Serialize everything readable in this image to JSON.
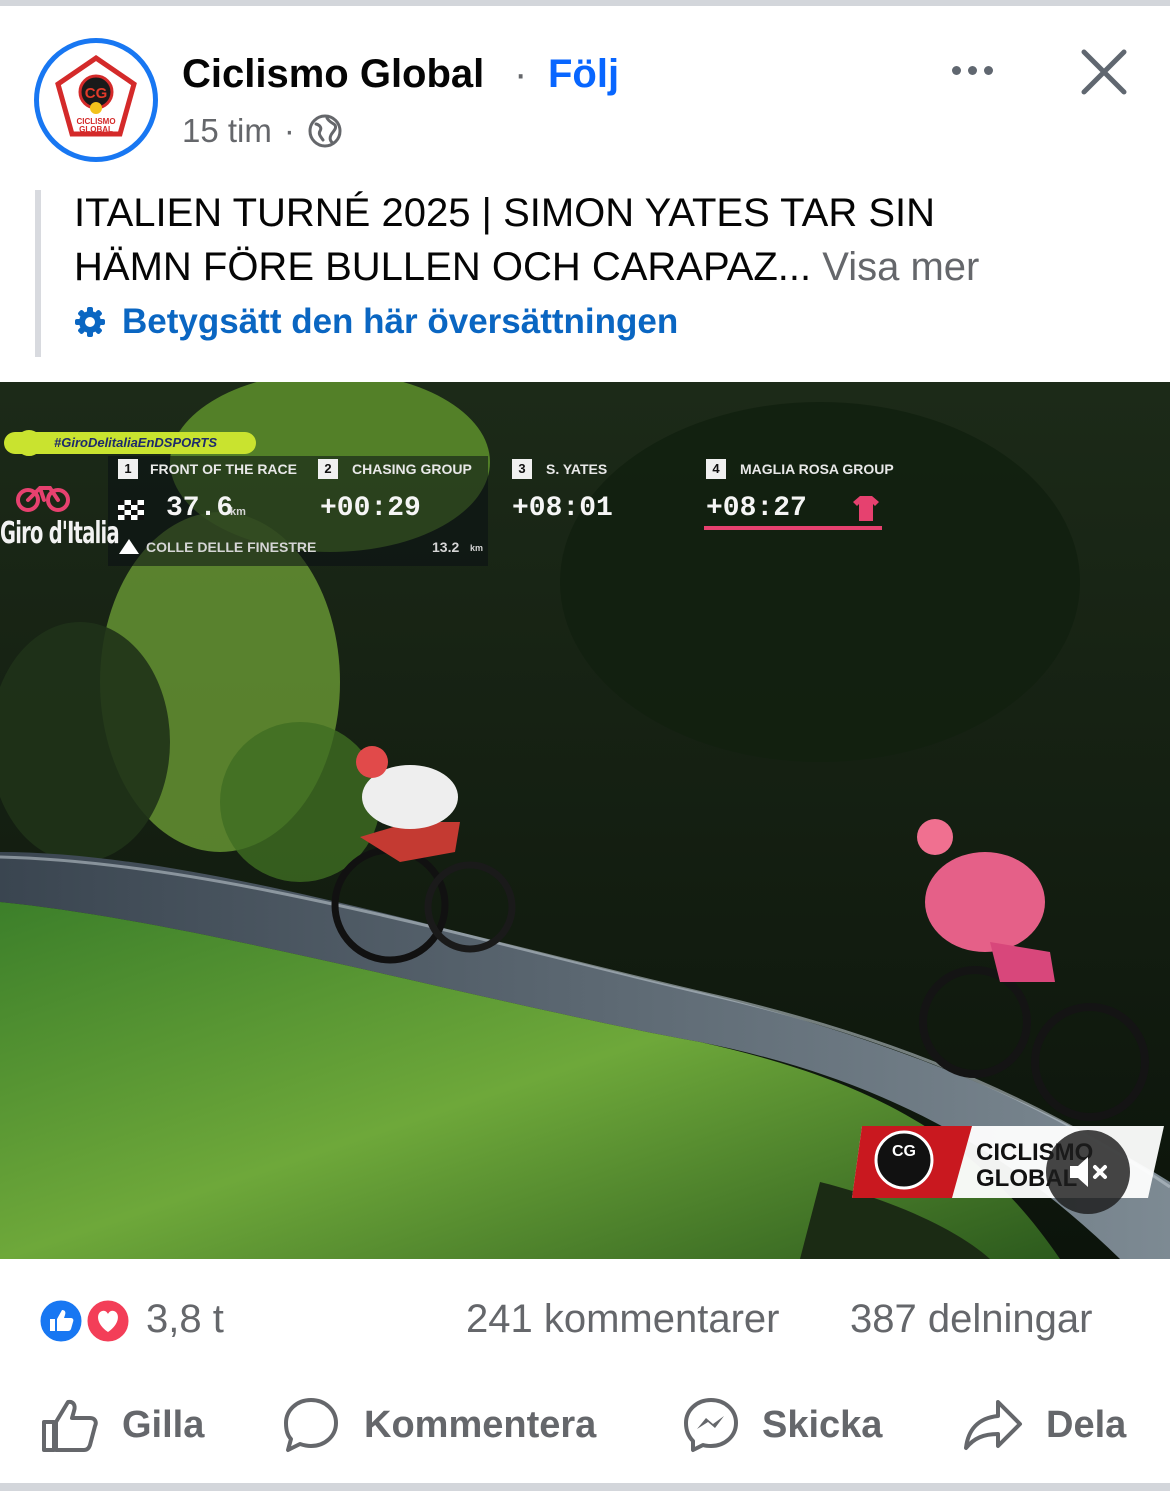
{
  "post": {
    "page_name": "Ciclismo Global",
    "separator": "·",
    "follow_label": "Följ",
    "time": "15 tim",
    "time_separator": "·",
    "caption_line1": "ITALIEN TURNÉ 2025 | SIMON YATES TAR SIN",
    "caption_line2": "HÄMN FÖRE BULLEN OCH CARAPAZ...",
    "see_more": "Visa mer",
    "rate_translation": "Betygsätt den här översättningen",
    "avatar_logo_initials": "CG",
    "avatar_logo_text": "CICLISMO GLOBAL"
  },
  "video": {
    "hashtag": "#GiroDelitaliaEnDSPORTS",
    "brand": "Giro d'Italia",
    "items": [
      {
        "num": "1",
        "label": "FRONT OF THE RACE",
        "value": "37.6",
        "unit": "km"
      },
      {
        "num": "2",
        "label": "CHASING GROUP",
        "value": "+00:29"
      },
      {
        "num": "3",
        "label": "S. YATES",
        "value": "+08:01"
      },
      {
        "num": "4",
        "label": "MAGLIA ROSA GROUP",
        "value": "+08:27"
      }
    ],
    "climb_name": "COLLE DELLE FINESTRE",
    "climb_distance": "13.2",
    "climb_unit": "km",
    "watermark_initials": "CG",
    "watermark_line1": "CICLISMO",
    "watermark_line2": "GLOBAL",
    "muted": true
  },
  "stats": {
    "reactions_count": "3,8 t",
    "comments": "241 kommentarer",
    "shares": "387 delningar"
  },
  "actions": {
    "like": "Gilla",
    "comment": "Kommentera",
    "send": "Skicka",
    "share": "Dela"
  },
  "colors": {
    "accent": "#0866ff",
    "secondary_text": "#65676b",
    "like_blue": "#1877f2",
    "love_red": "#f33e58",
    "maglia_rosa": "#e6416f"
  }
}
